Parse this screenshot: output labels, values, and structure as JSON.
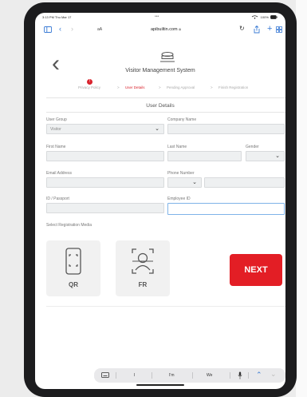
{
  "status_bar": {
    "time_date": "3:13 PM  Thu Mar 17",
    "dots": "•••",
    "battery": "100%"
  },
  "browser": {
    "text_size": "aA",
    "url": "apibuiltin.com",
    "icons": [
      "sidebar-icon",
      "back-arrow-icon",
      "forward-arrow-icon",
      "reload-icon",
      "share-icon",
      "new-tab-icon",
      "tabs-icon"
    ]
  },
  "header": {
    "title": "Visitor Management System"
  },
  "steps": [
    {
      "label": "Privacy Policy",
      "state": "error"
    },
    {
      "label": "User Details",
      "state": "active"
    },
    {
      "label": "Pending Approval",
      "state": "inactive"
    },
    {
      "label": "Finish Registration",
      "state": "inactive"
    }
  ],
  "steps_separator": ">",
  "step_error_mark": "!",
  "section_title": "User Details",
  "form": {
    "user_group": {
      "label": "User Group",
      "value": "Visitor"
    },
    "company_name": {
      "label": "Company Name",
      "value": ""
    },
    "first_name": {
      "label": "First Name",
      "value": ""
    },
    "last_name": {
      "label": "Last Name",
      "value": ""
    },
    "gender": {
      "label": "Gender",
      "value": ""
    },
    "email": {
      "label": "Email Address",
      "value": ""
    },
    "phone": {
      "label": "Phone Number",
      "code": "",
      "value": ""
    },
    "id_passport": {
      "label": "ID / Passport",
      "value": ""
    },
    "employee_id": {
      "label": "Employee ID",
      "value": ""
    }
  },
  "media": {
    "label": "Select Registration Media",
    "options": [
      {
        "label": "QR",
        "icon": "qr-scan-icon"
      },
      {
        "label": "FR",
        "icon": "face-scan-icon"
      }
    ]
  },
  "next_button": "NEXT",
  "keyboard_bar": {
    "suggestions": [
      "I",
      "I'm",
      "We"
    ]
  },
  "colors": {
    "accent": "#e31e25",
    "link": "#3a7bd5",
    "field_bg": "#eef0f1",
    "focus_border": "#7fb3e8"
  }
}
